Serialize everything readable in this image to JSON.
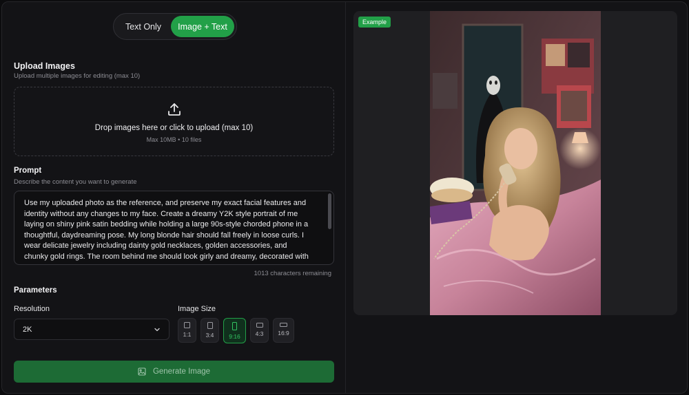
{
  "mode_toggle": {
    "text_only": "Text Only",
    "image_text": "Image + Text",
    "active": "Image + Text"
  },
  "upload": {
    "title": "Upload Images",
    "subtitle": "Upload multiple images for editing (max 10)",
    "drop_text": "Drop images here or click to upload (max 10)",
    "limits": "Max 10MB • 10 files",
    "icon": "upload-icon"
  },
  "prompt": {
    "title": "Prompt",
    "subtitle": "Describe the content you want to generate",
    "value": "Use my uploaded photo as the reference, and preserve my exact facial features and identity without any changes to my face. Create a dreamy Y2K style portrait of me laying on shiny pink satin bedding while holding a large 90s-style chorded phone in a thoughtful, daydreaming pose. My long blonde hair should fall freely in loose curls. I wear delicate jewelry including dainty gold necklaces, golden accessories, and chunky gold rings. The room behind me should look girly and dreamy, decorated with",
    "chars_remaining": "1013 characters remaining"
  },
  "parameters": {
    "title": "Parameters",
    "resolution_label": "Resolution",
    "resolution_value": "2K",
    "image_size_label": "Image Size",
    "sizes": [
      {
        "ratio": "1:1"
      },
      {
        "ratio": "3:4"
      },
      {
        "ratio": "9:16"
      },
      {
        "ratio": "4:3"
      },
      {
        "ratio": "16:9"
      }
    ],
    "selected_size": "9:16"
  },
  "generate_button": {
    "label": "Generate Image",
    "icon": "image-icon"
  },
  "preview": {
    "badge": "Example"
  },
  "colors": {
    "accent": "#22a048",
    "background": "#131316",
    "panel": "#1f1f22"
  }
}
